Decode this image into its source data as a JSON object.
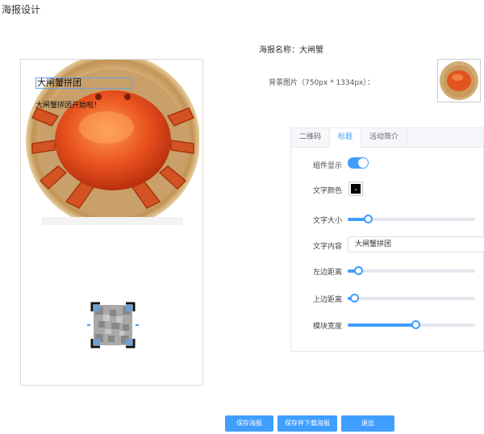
{
  "page": {
    "title": "海报设计"
  },
  "preview": {
    "title_text": "大闸蟹拼团",
    "subtitle_text": "大闸蟹拼团开始啦！"
  },
  "settings": {
    "poster_name_label": "海报名称：",
    "poster_name_value": "大闸蟹",
    "bg_label": "背景图片（750px * 1334px）："
  },
  "tabs": [
    "二维码",
    "标题",
    "活动简介"
  ],
  "active_tab": "标题",
  "form": {
    "show_label": "组件显示",
    "show_value": true,
    "color_label": "文字颜色",
    "text_color": "#000000",
    "size_label": "文字大小",
    "size_value": 0.16,
    "content_label": "文字内容",
    "content_value": "大闸蟹拼团",
    "left_label": "左边距离",
    "left_value": 0.08,
    "top_label": "上边距离",
    "top_value": 0.05,
    "width_label": "模块宽度",
    "width_value": 0.53
  },
  "buttons": {
    "save": "保存海报",
    "save_download": "保存并下载海报",
    "exit": "退出"
  },
  "colors": {
    "accent": "#409eff"
  }
}
